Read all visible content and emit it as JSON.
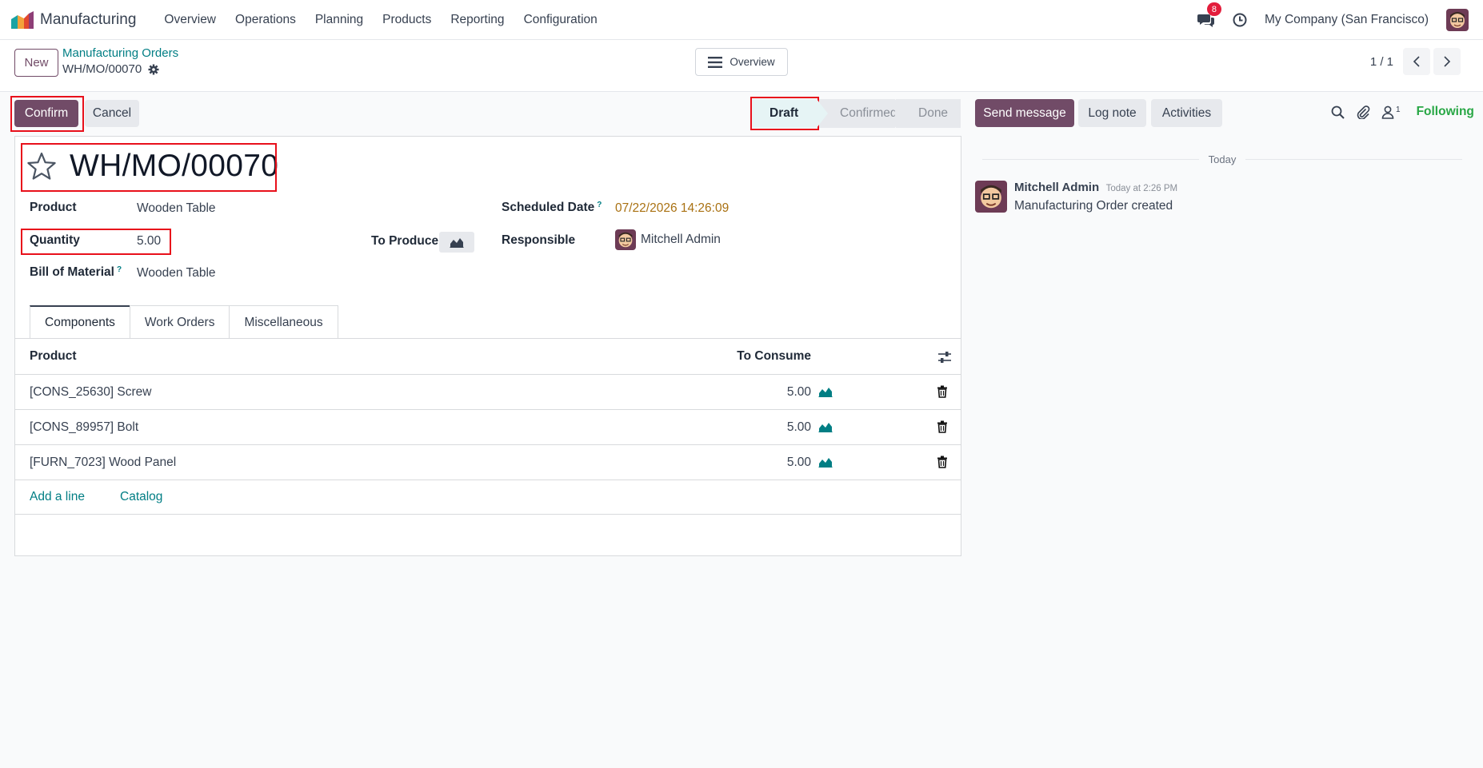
{
  "navbar": {
    "app_name": "Manufacturing",
    "menu": [
      "Overview",
      "Operations",
      "Planning",
      "Products",
      "Reporting",
      "Configuration"
    ],
    "notification_count": "8",
    "company": "My Company (San Francisco)"
  },
  "control": {
    "new_label": "New",
    "breadcrumb_parent": "Manufacturing Orders",
    "breadcrumb_current": "WH/MO/00070",
    "overview_label": "Overview",
    "pager": "1 / 1"
  },
  "actions": {
    "confirm_label": "Confirm",
    "cancel_label": "Cancel"
  },
  "statusbar": {
    "stages": [
      "Draft",
      "Confirmed",
      "Done"
    ],
    "active": "Draft"
  },
  "form": {
    "title": "WH/MO/00070",
    "product_label": "Product",
    "product_value": "Wooden Table",
    "quantity_label": "Quantity",
    "quantity_value": "5.00",
    "to_produce_label": "To Produce",
    "bom_label": "Bill of Material",
    "bom_help": "?",
    "bom_value": "Wooden Table",
    "scheduled_label": "Scheduled Date",
    "scheduled_help": "?",
    "scheduled_value": "07/22/2026 14:26:09",
    "responsible_label": "Responsible",
    "responsible_value": "Mitchell Admin"
  },
  "tabs": [
    "Components",
    "Work Orders",
    "Miscellaneous"
  ],
  "components": {
    "headers": {
      "product": "Product",
      "to_consume": "To Consume"
    },
    "rows": [
      {
        "product": "[CONS_25630] Screw",
        "qty": "5.00"
      },
      {
        "product": "[CONS_89957] Bolt",
        "qty": "5.00"
      },
      {
        "product": "[FURN_7023] Wood Panel",
        "qty": "5.00"
      }
    ],
    "add_line": "Add a line",
    "catalog": "Catalog"
  },
  "chatter": {
    "send_message": "Send message",
    "log_note": "Log note",
    "activities": "Activities",
    "follower_count": "1",
    "following": "Following",
    "today": "Today",
    "message": {
      "author": "Mitchell Admin",
      "time": "Today at 2:26 PM",
      "body": "Manufacturing Order created"
    }
  },
  "colors": {
    "brand": "#714b67",
    "link": "#017e84",
    "following": "#28a745",
    "highlight_box": "#e8101b",
    "date": "#a97112"
  }
}
